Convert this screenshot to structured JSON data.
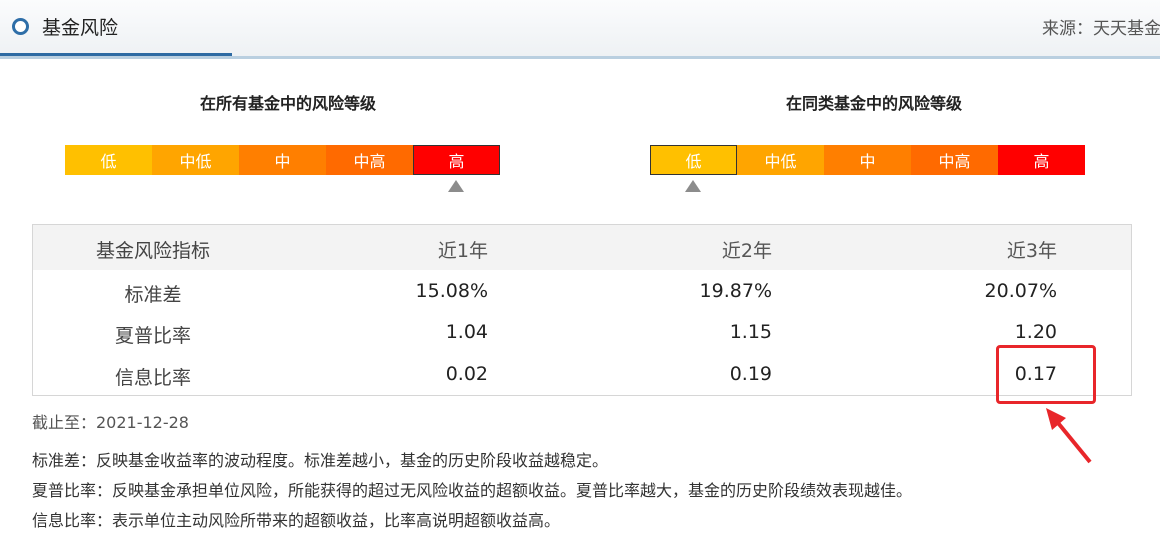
{
  "header": {
    "title": "基金风险",
    "source": "来源：天天基金"
  },
  "scales": [
    {
      "title": "在所有基金中的风险等级",
      "active_index": 4
    },
    {
      "title": "在同类基金中的风险等级",
      "active_index": 0
    }
  ],
  "levels": [
    {
      "label": "低",
      "color": "#ffc000"
    },
    {
      "label": "中低",
      "color": "#ffa500"
    },
    {
      "label": "中",
      "color": "#ff7f00"
    },
    {
      "label": "中高",
      "color": "#ff6a00"
    },
    {
      "label": "高",
      "color": "#ff0000"
    }
  ],
  "table": {
    "headers": [
      "基金风险指标",
      "近1年",
      "近2年",
      "近3年"
    ],
    "rows": [
      {
        "label": "标准差",
        "values": [
          "15.08%",
          "19.87%",
          "20.07%"
        ]
      },
      {
        "label": "夏普比率",
        "values": [
          "1.04",
          "1.15",
          "1.20"
        ]
      },
      {
        "label": "信息比率",
        "values": [
          "0.02",
          "0.19",
          "0.17"
        ]
      }
    ]
  },
  "cutoff": "截止至：2021-12-28",
  "notes": [
    "标准差：反映基金收益率的波动程度。标准差越小，基金的历史阶段收益越稳定。",
    "夏普比率：反映基金承担单位风险，所能获得的超过无风险收益的超额收益。夏普比率越大，基金的历史阶段绩效表现越佳。",
    "信息比率：表示单位主动风险所带来的超额收益，比率高说明超额收益高。"
  ],
  "annotation_color": "#e8262a"
}
